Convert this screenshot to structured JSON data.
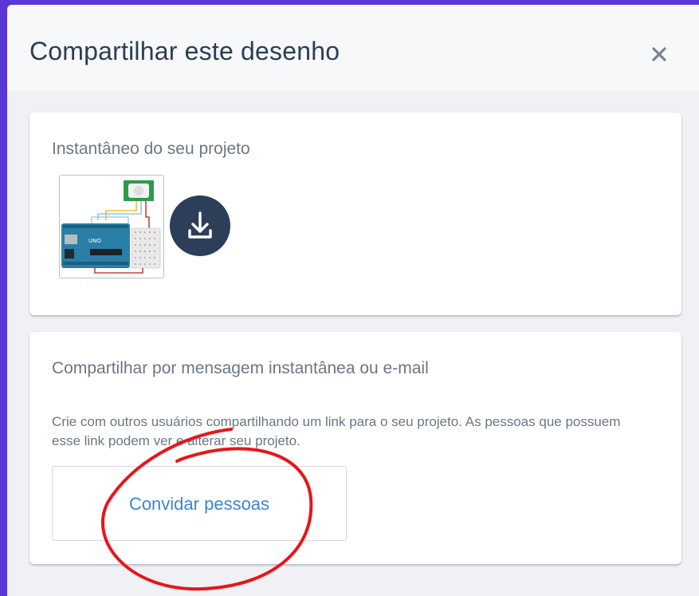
{
  "dialog": {
    "title": "Compartilhar este desenho",
    "close_icon": "close-icon"
  },
  "snapshot": {
    "heading": "Instantâneo do seu projeto",
    "thumbnail_icon": "circuit-preview-thumbnail",
    "download_icon": "download-icon"
  },
  "share": {
    "heading": "Compartilhar por mensagem instantânea ou e-mail",
    "description": "Crie com outros usuários compartilhando um link para o seu projeto. As pessoas que possuem esse link podem ver e alterar seu projeto.",
    "invite_label": "Convidar pessoas"
  },
  "colors": {
    "page_background": "#5b36d6",
    "dialog_background": "#eff1f5",
    "title_text": "#2c3e55",
    "download_button": "#2c3e58",
    "link_blue": "#3b86d6",
    "annotation_red": "#e8151c"
  }
}
